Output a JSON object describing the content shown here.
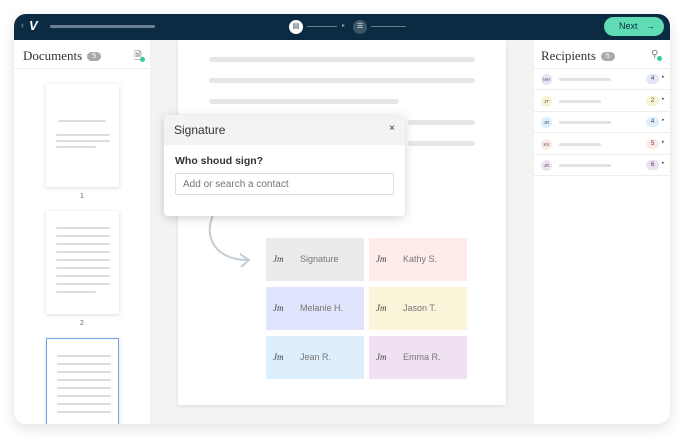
{
  "header": {
    "next_label": "Next",
    "next_arrow": "→",
    "back_icon": "‹",
    "logo": "V"
  },
  "documents": {
    "title": "Documents",
    "count": "5",
    "pages": [
      "1",
      "2"
    ]
  },
  "popup": {
    "title": "Signature",
    "close": "×",
    "question": "Who shoud sign?",
    "placeholder": "Add or search a contact"
  },
  "cards": [
    {
      "label": "Signature",
      "color": "#ebebeb"
    },
    {
      "label": "Kathy S.",
      "color": "#fdecea"
    },
    {
      "label": "Melanie H.",
      "color": "#dfe3fb"
    },
    {
      "label": "Jason T.",
      "color": "#faf5d9"
    },
    {
      "label": "Jean R.",
      "color": "#ddeefc"
    },
    {
      "label": "Emma R.",
      "color": "#efe1f1"
    }
  ],
  "sig_glyph": "Jm",
  "recipients": {
    "title": "Recipients",
    "count": "5",
    "items": [
      {
        "initials": "MH",
        "count": "4",
        "color": "#e2e6fb"
      },
      {
        "initials": "JT",
        "count": "2",
        "color": "#faf3d3"
      },
      {
        "initials": "JR",
        "count": "4",
        "color": "#dceefc"
      },
      {
        "initials": "KS",
        "count": "5",
        "color": "#fde8e6"
      },
      {
        "initials": "JR",
        "count": "6",
        "color": "#efdff2"
      }
    ]
  }
}
